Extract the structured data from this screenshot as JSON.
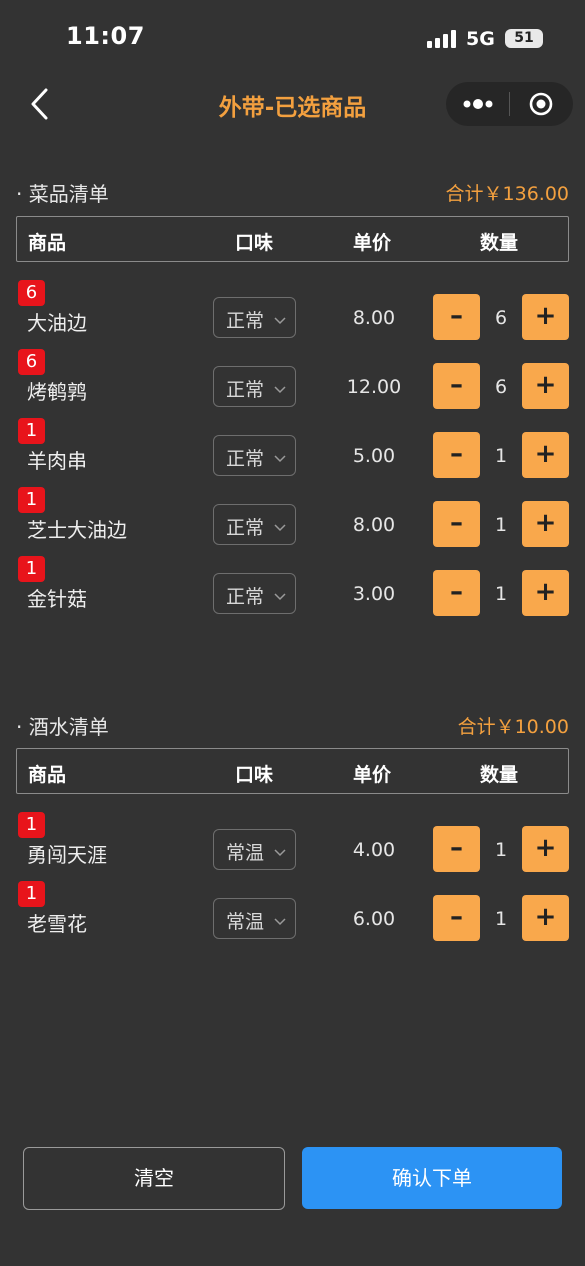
{
  "status_bar": {
    "time": "11:07",
    "network": "5G",
    "battery": "51"
  },
  "nav": {
    "title": "外带-已选商品"
  },
  "dishes": {
    "title": "· 菜品清单",
    "total": "合计￥136.00",
    "headers": {
      "item": "商品",
      "flavor": "口味",
      "price": "单价",
      "qty": "数量"
    },
    "items": [
      {
        "badge": "6",
        "name": "大油边",
        "flavor": "正常",
        "price": "8.00",
        "qty": "6"
      },
      {
        "badge": "6",
        "name": "烤鹌鹑",
        "flavor": "正常",
        "price": "12.00",
        "qty": "6"
      },
      {
        "badge": "1",
        "name": "羊肉串",
        "flavor": "正常",
        "price": "5.00",
        "qty": "1"
      },
      {
        "badge": "1",
        "name": "芝士大油边",
        "flavor": "正常",
        "price": "8.00",
        "qty": "1"
      },
      {
        "badge": "1",
        "name": "金针菇",
        "flavor": "正常",
        "price": "3.00",
        "qty": "1"
      }
    ]
  },
  "drinks": {
    "title": "· 酒水清单",
    "total": "合计￥10.00",
    "headers": {
      "item": "商品",
      "flavor": "口味",
      "price": "单价",
      "qty": "数量"
    },
    "items": [
      {
        "badge": "1",
        "name": "勇闯天涯",
        "flavor": "常温",
        "price": "4.00",
        "qty": "1"
      },
      {
        "badge": "1",
        "name": "老雪花",
        "flavor": "常温",
        "price": "6.00",
        "qty": "1"
      }
    ]
  },
  "controls": {
    "minus": "–",
    "plus": "+"
  },
  "footer": {
    "clear": "清空",
    "confirm": "确认下单"
  },
  "colors": {
    "accent": "#f3a03f",
    "button": "#f9a84c",
    "badge": "#e8141b",
    "confirm": "#2c93f4",
    "background": "#333333"
  }
}
